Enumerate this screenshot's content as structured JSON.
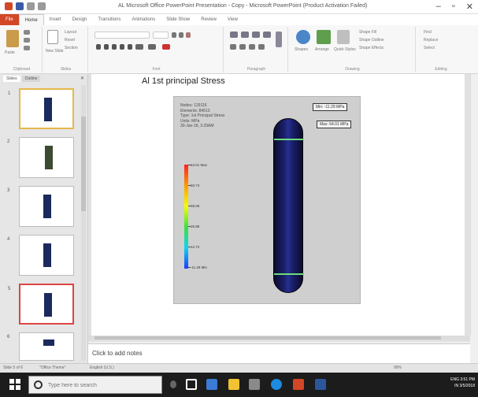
{
  "window": {
    "title": "AL Microsoft Office PowerPoint Presentation - Copy - Microsoft PowerPoint (Product Activation Failed)",
    "controls": [
      "–",
      "▫",
      "✕"
    ]
  },
  "ribbon_tabs": [
    "File",
    "Home",
    "Insert",
    "Design",
    "Transitions",
    "Animations",
    "Slide Show",
    "Review",
    "View"
  ],
  "ribbon_groups": [
    "Clipboard",
    "Slides",
    "Font",
    "Paragraph",
    "Drawing",
    "Editing"
  ],
  "ribbon_texts": {
    "layout": "Layout",
    "reset": "Reset",
    "section": "Section",
    "new_slide": "New Slide",
    "paste": "Paste",
    "shape_fill": "Shape Fill",
    "shape_outline": "Shape Outline",
    "shape_effects": "Shape Effects",
    "shapes": "Shapes",
    "arrange": "Arrange",
    "quick_styles": "Quick Styles",
    "find": "Find",
    "replace": "Replace",
    "select": "Select"
  },
  "left_pane": {
    "tabs": [
      "Slides",
      "Outline"
    ],
    "thumbnail_numbers": [
      "1",
      "2",
      "3",
      "4",
      "5",
      "6"
    ]
  },
  "slide": {
    "title": "Al 1st principal Stress",
    "info_lines": [
      "Nodes: 129116",
      "Elements: 84513",
      "Type: 1st Principal Stress",
      "Units: MPa",
      "30-Jan-18, 3:29AM"
    ],
    "legend_labels": [
      "64.01 Max",
      "50.74",
      "38.06",
      "25.88",
      "12.72",
      "-11.29 Min"
    ],
    "callout_min": "Min: -11.29 MPa",
    "callout_max": "Max: 64.01 MPa"
  },
  "notes": {
    "placeholder": "Click to add notes"
  },
  "status": {
    "slide_of": "Slide 5 of 6",
    "theme": "\"Office Theme\"",
    "language": "English (U.S.)",
    "zoom": "90%"
  },
  "taskbar": {
    "search_placeholder": "Type here to search",
    "time": "3:51 PM",
    "date": "3/5/2018",
    "lang": "ENG",
    "lang2": "IN"
  },
  "colors": {
    "file_tab": "#d24726",
    "taskbar": "#1c1c1c",
    "selected_thumb_border": "#e6b84c",
    "capsule": "#1a1f6a"
  }
}
